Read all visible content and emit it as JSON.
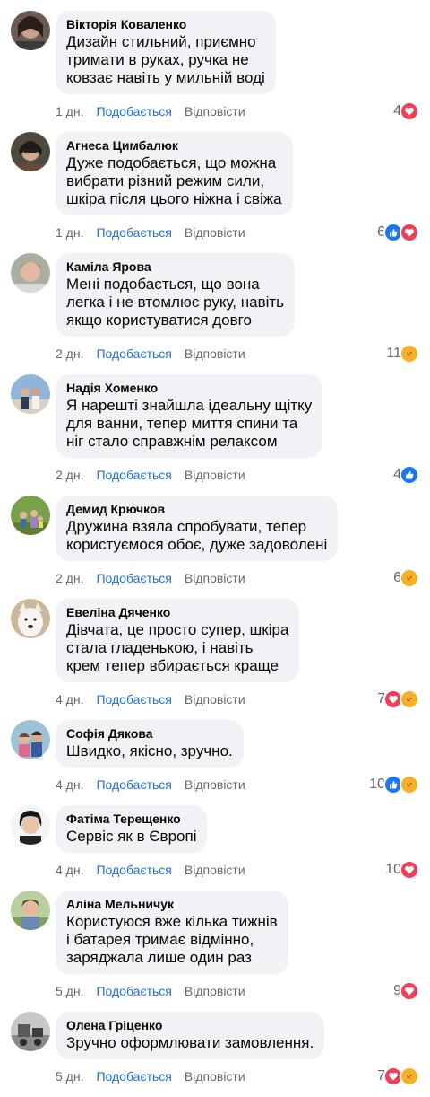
{
  "labels": {
    "like": "Подобається",
    "reply": "Відповісти"
  },
  "colors": {
    "like_link": "#216fdb",
    "bubble": "#f0f2f5",
    "heart": "#f33e58",
    "like_reaction": "#1877f2",
    "care": "#f7b125"
  },
  "comments": [
    {
      "author": "Вікторія Коваленко",
      "text": "Дизайн стильний, приємно\nтримати в руках, ручка не\nковзає навіть у мильній воді",
      "time": "1 дн.",
      "count": "4",
      "reactions": [
        "heart-icon"
      ]
    },
    {
      "author": "Агнеса Цимбалюк",
      "text": "Дуже подобається, що можна\nвибрати різний режим сили,\nшкіра після цього ніжна і свіжа",
      "time": "1 дн.",
      "count": "6",
      "reactions": [
        "like-icon",
        "heart-icon"
      ]
    },
    {
      "author": "Каміла Ярова",
      "text": "Мені подобається, що вона\nлегка і не втомлює руку, навіть\nякщо користуватися довго",
      "time": "2 дн.",
      "count": "11",
      "reactions": [
        "care-icon"
      ]
    },
    {
      "author": "Надія Хоменко",
      "text": "Я нарешті знайшла ідеальну щітку\nдля ванни, тепер миття спини та\nніг стало справжнім релаксом",
      "time": "2 дн.",
      "count": "4",
      "reactions": [
        "like-icon"
      ]
    },
    {
      "author": "Демид Крючков",
      "text": "Дружина взяла спробувати, тепер\nкористуємося обоє, дуже задоволені",
      "time": "2 дн.",
      "count": "6",
      "reactions": [
        "care-icon"
      ]
    },
    {
      "author": "Евеліна Дяченко",
      "text": "Дівчата, це просто супер, шкіра\nстала гладенькою, і навіть\nкрем тепер вбирається краще",
      "time": "4 дн.",
      "count": "7",
      "reactions": [
        "heart-icon",
        "care-icon"
      ]
    },
    {
      "author": "Софія Дякова",
      "text": "Швидко, якісно, зручно.",
      "time": "4 дн.",
      "count": "10",
      "reactions": [
        "like-icon",
        "care-icon"
      ]
    },
    {
      "author": "Фатіма Терещенко",
      "text": "Сервіс як в Європі",
      "time": "4 дн.",
      "count": "10",
      "reactions": [
        "heart-icon"
      ]
    },
    {
      "author": "Аліна Мельничук",
      "text": "Користуюся вже кілька тижнів\nі батарея тримає відмінно,\nзаряджала лише один раз",
      "time": "5 дн.",
      "count": "9",
      "reactions": [
        "heart-icon"
      ]
    },
    {
      "author": "Олена Гріценко",
      "text": "Зручно оформлювати замовлення.",
      "time": "5 дн.",
      "count": "7",
      "reactions": [
        "heart-icon",
        "care-icon"
      ]
    }
  ]
}
